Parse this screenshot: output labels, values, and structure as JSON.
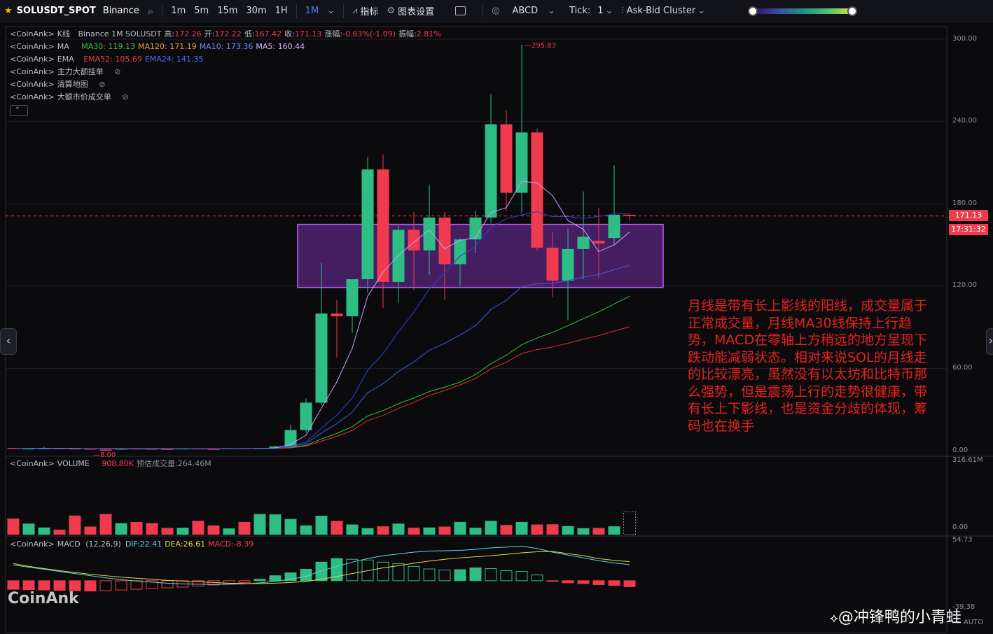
{
  "toolbar": {
    "symbol": "SOLUSDT_SPOT",
    "exchange": "Binance",
    "intervals": [
      "1m",
      "5m",
      "15m",
      "30m",
      "1H",
      "1M"
    ],
    "active_interval": "1M",
    "indicators_label": "指标",
    "chart_settings_label": "图表设置",
    "drawing_label": "ABCD",
    "tick_label": "Tick:",
    "tick_value": "1",
    "cluster_label": "Ask-Bid Cluster"
  },
  "legend": {
    "kline": {
      "prefix": "<CoinAnk>",
      "name": "K线",
      "desc": "Binance 1M SOLUSDT",
      "high_label": "高:",
      "high": "172.26",
      "open_label": "开:",
      "open": "172.22",
      "low_label": "低:",
      "low": "167.42",
      "close_label": "收:",
      "close": "171.13",
      "chg_label": "涨幅:",
      "chg": "-0.63%(-1.09)",
      "amp_label": "振幅:",
      "amp": "2.81%"
    },
    "ma": {
      "prefix": "<CoinAnk>",
      "name": "MA",
      "ma30": "MA30: 119.13",
      "ma120": "MA120: 171.19",
      "ma10": "MA10: 173.36",
      "ma5": "MA5: 160.44"
    },
    "ema": {
      "prefix": "<CoinAnk>",
      "name": "EMA",
      "ema52": "EMA52: 105.69",
      "ema24": "EMA24: 141.35"
    },
    "big_orders": {
      "prefix": "<CoinAnk>",
      "name": "主力大额挂单"
    },
    "liq_map": {
      "prefix": "<CoinAnk>",
      "name": "清算地图"
    },
    "big_market": {
      "prefix": "<CoinAnk>",
      "name": "大额市价成交单"
    },
    "volume": {
      "prefix": "<CoinAnk>",
      "name": "VOLUME",
      "value": "908.80K",
      "est": "预估成交量:264.46M"
    },
    "macd": {
      "prefix": "<CoinAnk>",
      "name": "MACD",
      "params": "(12,26,9)",
      "dif": "DIF:22.41",
      "dea": "DEA:26.61",
      "macd": "MACD:-8.39"
    }
  },
  "axis": {
    "price_ticks": [
      "300.00",
      "240.00",
      "180.00",
      "120.00",
      "60.00",
      "0.00"
    ],
    "volume_ticks": [
      "316.61M",
      "0.00"
    ],
    "macd_ticks": [
      "54.73",
      "-39.38"
    ],
    "auto_label": "AUTO"
  },
  "price_tags": {
    "last": "171.13",
    "countdown": "17:31:32"
  },
  "annotations": {
    "high": "295.83",
    "low": "8.00"
  },
  "note": "月线是带有长上影线的阳线，成交量属于正常成交量，月线MA30线保持上行趋势，MACD在零轴上方稍远的地方呈现下跌动能减弱状态。相对来说SOL的月线走的比较漂亮，虽然没有以太坊和比特币那么强势，但是震荡上行的走势很健康，带有长上下影线，也是资金分歧的体现，筹码也在换手",
  "watermark": "CoinAnk",
  "author": "@冲锋鸭的小青蛙",
  "colors": {
    "up": "#2ebd85",
    "down": "#f03a4e",
    "bg": "#0b0b0e",
    "box": "#8b35c9",
    "ma30": "#3fbf3f",
    "ma120": "#e02020",
    "ma10": "#2a3ee0",
    "ma5": "#c9a0f5",
    "ema52": "#e03030",
    "ema24": "#3e5be0",
    "dif": "#6cd0e8",
    "dea": "#e8d44d"
  },
  "chart_data": {
    "type": "candlestick",
    "price_ylim": [
      0,
      300
    ],
    "volume_ylim": [
      0,
      316.61
    ],
    "macd_ylim": [
      -39.38,
      54.73
    ],
    "candles": [
      {
        "o": 2.0,
        "h": 2.1,
        "l": 1.0,
        "c": 1.5
      },
      {
        "o": 1.5,
        "h": 2.0,
        "l": 1.0,
        "c": 1.7
      },
      {
        "o": 1.6,
        "h": 2.6,
        "l": 1.0,
        "c": 1.9
      },
      {
        "o": 1.9,
        "h": 2.0,
        "l": 1.3,
        "c": 1.7
      },
      {
        "o": 1.7,
        "h": 2.2,
        "l": 1.0,
        "c": 1.6
      },
      {
        "o": 1.6,
        "h": 1.7,
        "l": 0.5,
        "c": 0.8
      },
      {
        "o": 0.8,
        "h": 1.0,
        "l": 0.6,
        "c": 0.7
      },
      {
        "o": 0.8,
        "h": 2.0,
        "l": 0.7,
        "c": 1.7
      },
      {
        "o": 1.7,
        "h": 2.2,
        "l": 1.5,
        "c": 1.6
      },
      {
        "o": 1.6,
        "h": 1.8,
        "l": 1.3,
        "c": 1.4
      },
      {
        "o": 1.4,
        "h": 1.6,
        "l": 1.2,
        "c": 1.3
      },
      {
        "o": 1.3,
        "h": 1.8,
        "l": 1.2,
        "c": 1.7
      },
      {
        "o": 1.7,
        "h": 1.9,
        "l": 1.4,
        "c": 1.5
      },
      {
        "o": 1.4,
        "h": 1.7,
        "l": 1.2,
        "c": 1.3
      },
      {
        "o": 1.3,
        "h": 1.9,
        "l": 1.2,
        "c": 1.8
      },
      {
        "o": 1.8,
        "h": 1.9,
        "l": 1.3,
        "c": 1.4
      },
      {
        "o": 1.4,
        "h": 2.2,
        "l": 1.3,
        "c": 2.0
      },
      {
        "o": 2.0,
        "h": 3.5,
        "l": 1.6,
        "c": 3.0
      },
      {
        "o": 3.0,
        "h": 19.0,
        "l": 2.7,
        "c": 15.0
      },
      {
        "o": 15.0,
        "h": 38.0,
        "l": 13.0,
        "c": 35.0
      },
      {
        "o": 35.0,
        "h": 137.0,
        "l": 33.0,
        "c": 100.0
      },
      {
        "o": 100.0,
        "h": 110.0,
        "l": 68.0,
        "c": 98.0
      },
      {
        "o": 98.0,
        "h": 125.0,
        "l": 86.0,
        "c": 125.0
      },
      {
        "o": 125.0,
        "h": 214.0,
        "l": 115.0,
        "c": 205.0
      },
      {
        "o": 205.0,
        "h": 216.0,
        "l": 104.0,
        "c": 123.0
      },
      {
        "o": 123.0,
        "h": 164.0,
        "l": 108.0,
        "c": 161.0
      },
      {
        "o": 161.0,
        "h": 174.0,
        "l": 117.0,
        "c": 146.0
      },
      {
        "o": 146.0,
        "h": 194.0,
        "l": 128.0,
        "c": 170.0
      },
      {
        "o": 170.0,
        "h": 174.0,
        "l": 110.0,
        "c": 136.0
      },
      {
        "o": 136.0,
        "h": 155.0,
        "l": 120.0,
        "c": 154.0
      },
      {
        "o": 154.0,
        "h": 175.0,
        "l": 144.0,
        "c": 170.0
      },
      {
        "o": 170.0,
        "h": 260.0,
        "l": 166.0,
        "c": 238.0
      },
      {
        "o": 238.0,
        "h": 248.0,
        "l": 175.0,
        "c": 188.0
      },
      {
        "o": 188.0,
        "h": 296.0,
        "l": 173.0,
        "c": 232.0
      },
      {
        "o": 232.0,
        "h": 235.0,
        "l": 146.0,
        "c": 148.0
      },
      {
        "o": 148.0,
        "h": 159.0,
        "l": 112.0,
        "c": 124.0
      },
      {
        "o": 124.0,
        "h": 162.0,
        "l": 95.0,
        "c": 147.0
      },
      {
        "o": 147.0,
        "h": 189.0,
        "l": 125.0,
        "c": 156.0
      },
      {
        "o": 153.0,
        "h": 177.0,
        "l": 126.0,
        "c": 151.0
      },
      {
        "o": 155.0,
        "h": 208.0,
        "l": 150.0,
        "c": 172.0
      },
      {
        "o": 172.0,
        "h": 172.26,
        "l": 167.42,
        "c": 171.13
      }
    ],
    "volume": [
      70.0,
      48.0,
      31.0,
      22.0,
      83.0,
      35.0,
      90.0,
      50.0,
      55.0,
      50.0,
      29.0,
      30.0,
      60.0,
      40.0,
      27.0,
      55.0,
      90.0,
      88.0,
      68.0,
      40.0,
      82.0,
      60.0,
      44.0,
      28.0,
      36.0,
      48.0,
      30.0,
      31.0,
      35.0,
      55.0,
      30.0,
      60.0,
      42.0,
      55.0,
      44.0,
      45.0,
      37.0,
      28.0,
      29.0,
      36.0,
      0.5
    ],
    "macd_hist": [
      -12.0,
      -12.5,
      -13.0,
      -13.5,
      -14.0,
      -14.5,
      -14.0,
      -13.0,
      -12.0,
      -11.0,
      -10.0,
      -9.0,
      -7.5,
      -6.0,
      -4.5,
      -2.5,
      2.0,
      7.0,
      11.0,
      16.0,
      26.0,
      31.0,
      30.0,
      29.0,
      26.0,
      24.0,
      20.0,
      16.5,
      15.0,
      15.5,
      18.0,
      17.0,
      14.0,
      13.0,
      8.0,
      -1.0,
      -3.0,
      -4.0,
      -5.5,
      -6.5,
      -8.39
    ],
    "macd_dif": [
      22.0,
      19.0,
      16.0,
      13.0,
      10.0,
      7.0,
      4.0,
      1.5,
      -0.5,
      -2.0,
      -3.5,
      -4.5,
      -5.0,
      -5.2,
      -5.0,
      -4.5,
      -3.0,
      -1.0,
      2.0,
      6.0,
      14.0,
      20.0,
      26.0,
      31.0,
      35.0,
      37.5,
      40.0,
      41.5,
      42.0,
      42.5,
      44.0,
      46.0,
      47.0,
      48.5,
      45.0,
      40.0,
      36.0,
      32.0,
      28.0,
      25.0,
      22.41
    ],
    "macd_dea": [
      24.0,
      20.0,
      17.0,
      14.0,
      11.5,
      9.0,
      7.0,
      5.0,
      3.5,
      2.0,
      0.5,
      -0.5,
      -1.5,
      -2.5,
      -3.5,
      -4.0,
      -4.0,
      -3.5,
      -2.5,
      -1.0,
      2.0,
      6.0,
      10.0,
      14.0,
      18.0,
      21.0,
      24.5,
      27.5,
      30.0,
      32.0,
      33.5,
      35.0,
      37.0,
      39.0,
      40.5,
      41.0,
      38.0,
      35.0,
      31.0,
      28.5,
      26.61
    ]
  }
}
